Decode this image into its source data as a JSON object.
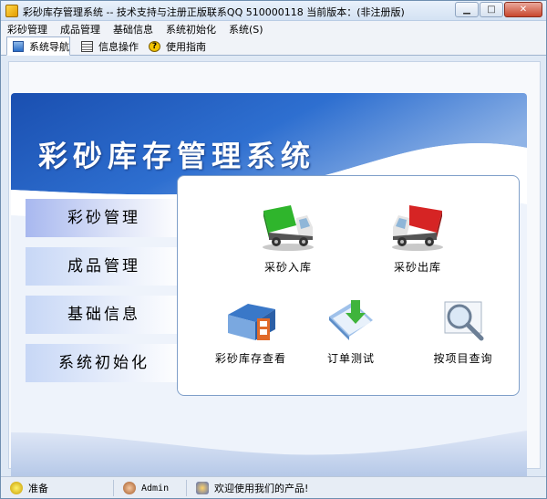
{
  "window": {
    "title": "彩砂库存管理系统 -- 技术支持与注册正版联系QQ 510000118    当前版本：(非注册版)",
    "controls": {
      "minimize": "▁",
      "maximize": "□",
      "close": "✕"
    }
  },
  "menu": [
    "彩砂管理",
    "成品管理",
    "基础信息",
    "系统初始化",
    "系统(S)"
  ],
  "tabs": [
    {
      "label": "系统导航",
      "icon": "navigation-icon"
    },
    {
      "label": "信息操作",
      "icon": "grid-icon"
    },
    {
      "label": "使用指南",
      "icon": "help-icon"
    }
  ],
  "banner": {
    "title": "彩砂库存管理系统"
  },
  "side_menu": [
    "彩砂管理",
    "成品管理",
    "基础信息",
    "系统初始化"
  ],
  "functions": [
    {
      "label": "采砂入库",
      "icon": "green-truck-icon"
    },
    {
      "label": "采砂出库",
      "icon": "red-truck-icon"
    },
    {
      "label": "彩砂库存查看",
      "icon": "warehouse-icon"
    },
    {
      "label": "订单测试",
      "icon": "document-download-icon"
    },
    {
      "label": "按项目查询",
      "icon": "magnifier-icon"
    }
  ],
  "status": {
    "ready": "准备",
    "user": "Admin",
    "welcome": "欢迎使用我们的产品!"
  },
  "colors": {
    "banner_blue": "#1d54b4",
    "panel_border": "#7f9fc9",
    "truck_green": "#2fb52c",
    "truck_red": "#d62424"
  }
}
